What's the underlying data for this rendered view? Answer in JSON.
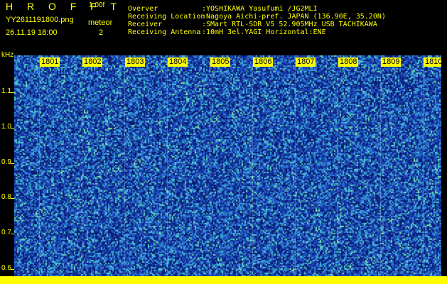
{
  "header": {
    "logo": "H R O F F T",
    "version": "1.00f",
    "filename": "YY2611191800.png",
    "datetime": "26.11.19 18:00",
    "meteor_label": "meteor",
    "meteor_count": "2",
    "info": [
      {
        "key": "Overver",
        "value": ":YOSHIKAWA Yasufumi /JG2MLI"
      },
      {
        "key": "Receiving Location",
        "value": ":Nagoya Aichi-pref. JAPAN (136.90E, 35.20N)"
      },
      {
        "key": "Receiver",
        "value": ":SMart RTL-SDR V5 52.905MHz USB TACHIKAWA"
      },
      {
        "key": "Receiving Antenna",
        "value": ":10mH 3el.YAGI Horizontal:ENE"
      }
    ]
  },
  "y_axis": {
    "unit": "kHz",
    "labels": [
      "1.1",
      "1.0",
      "0.9",
      "0.8",
      "0.7",
      "0.6"
    ]
  },
  "time_labels": [
    "1801",
    "1802",
    "1803",
    "1804",
    "1805",
    "1806",
    "1807",
    "1808",
    "1809",
    "1810"
  ],
  "colors": {
    "text": "#ffff00",
    "background": "#000000",
    "noise_base": "#12329a",
    "bottom_bar": "#ffff00"
  }
}
